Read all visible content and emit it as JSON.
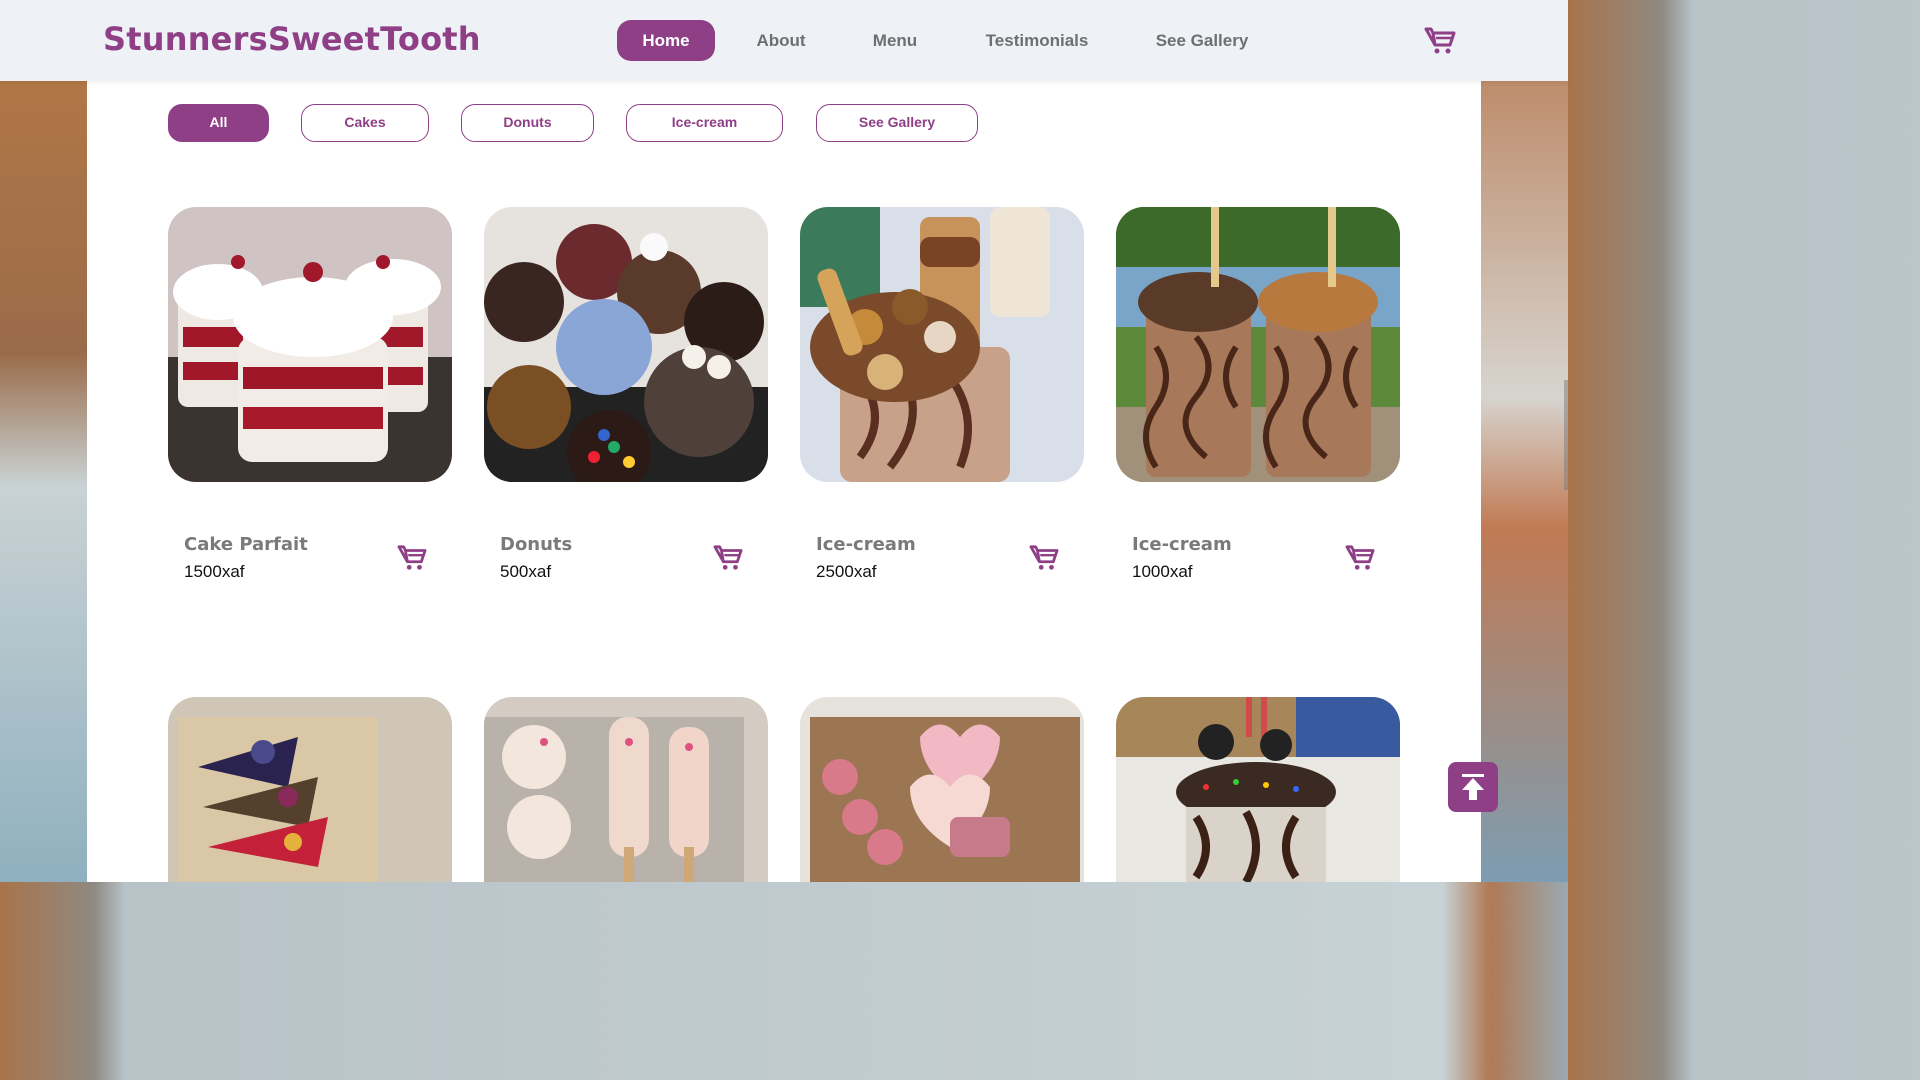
{
  "brand": {
    "name": "StunnersSweetTooth",
    "accent": "#8e3f86"
  },
  "nav": {
    "items": [
      {
        "label": "Home",
        "active": true
      },
      {
        "label": "About",
        "active": false
      },
      {
        "label": "Menu",
        "active": false
      },
      {
        "label": "Testimonials",
        "active": false
      },
      {
        "label": "See Gallery",
        "active": false
      }
    ],
    "cart_icon": "cart-icon"
  },
  "filters": [
    {
      "label": "All",
      "active": true
    },
    {
      "label": "Cakes",
      "active": false
    },
    {
      "label": "Donuts",
      "active": false
    },
    {
      "label": "Ice-cream",
      "active": false
    },
    {
      "label": "See Gallery",
      "active": false
    }
  ],
  "products": [
    {
      "name": "Cake Parfait",
      "price": "1500xaf",
      "image": "red velvet cake parfait cups"
    },
    {
      "name": "Donuts",
      "price": "500xaf",
      "image": "box of decorated donuts"
    },
    {
      "name": "Ice-cream",
      "price": "2500xaf",
      "image": "loaded chocolate milkshake"
    },
    {
      "name": "Ice-cream",
      "price": "1000xaf",
      "image": "two iced mocha frappes"
    }
  ],
  "products_row2": [
    {
      "image": "box of cheesecake slices"
    },
    {
      "image": "white chocolate cakesicles"
    },
    {
      "image": "pink heart cookies and cake pops"
    },
    {
      "image": "oreo freakshake"
    }
  ],
  "scroll_top_icon": "arrow-up-to-line-icon"
}
